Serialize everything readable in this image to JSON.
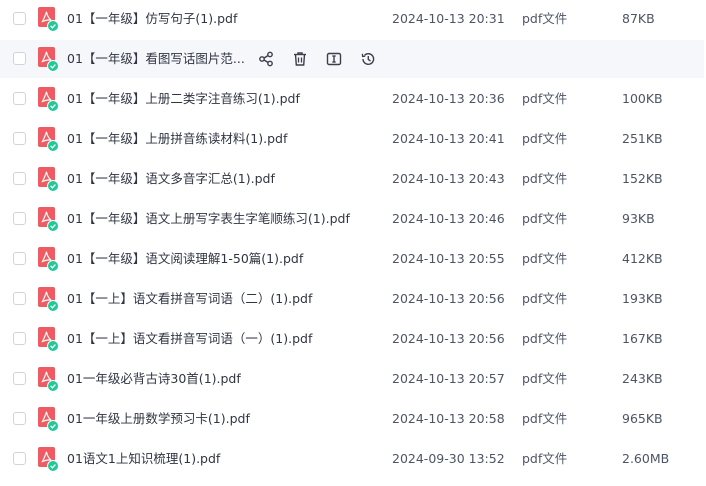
{
  "colors": {
    "pdf_icon": "#ef5b62",
    "check_badge": "#20c997",
    "hover_row": "#f6f7fa"
  },
  "icons": {
    "file_type": "pdf-file-icon",
    "badge": "check-badge-icon",
    "share": "share-icon",
    "delete": "trash-icon",
    "rename": "rename-icon",
    "history": "history-icon"
  },
  "files": [
    {
      "name": "01【一年级】仿写句子(1).pdf",
      "date": "2024-10-13 20:31",
      "type": "pdf文件",
      "size": "87KB"
    },
    {
      "name": "01【一年级】看图写话图片范...",
      "date": "",
      "type": "",
      "size": ""
    },
    {
      "name": "01【一年级】上册二类字注音练习(1).pdf",
      "date": "2024-10-13 20:36",
      "type": "pdf文件",
      "size": "100KB"
    },
    {
      "name": "01【一年级】上册拼音练读材料(1).pdf",
      "date": "2024-10-13 20:41",
      "type": "pdf文件",
      "size": "251KB"
    },
    {
      "name": "01【一年级】语文多音字汇总(1).pdf",
      "date": "2024-10-13 20:43",
      "type": "pdf文件",
      "size": "152KB"
    },
    {
      "name": "01【一年级】语文上册写字表生字笔顺练习(1).pdf",
      "date": "2024-10-13 20:46",
      "type": "pdf文件",
      "size": "93KB"
    },
    {
      "name": "01【一年级】语文阅读理解1-50篇(1).pdf",
      "date": "2024-10-13 20:55",
      "type": "pdf文件",
      "size": "412KB"
    },
    {
      "name": "01【一上】语文看拼音写词语（二）(1).pdf",
      "date": "2024-10-13 20:56",
      "type": "pdf文件",
      "size": "193KB"
    },
    {
      "name": "01【一上】语文看拼音写词语（一）(1).pdf",
      "date": "2024-10-13 20:56",
      "type": "pdf文件",
      "size": "167KB"
    },
    {
      "name": "01一年级必背古诗30首(1).pdf",
      "date": "2024-10-13 20:57",
      "type": "pdf文件",
      "size": "243KB"
    },
    {
      "name": "01一年级上册数学预习卡(1).pdf",
      "date": "2024-10-13 20:58",
      "type": "pdf文件",
      "size": "965KB"
    },
    {
      "name": "01语文1上知识梳理(1).pdf",
      "date": "2024-09-30 13:52",
      "type": "pdf文件",
      "size": "2.60MB"
    }
  ]
}
